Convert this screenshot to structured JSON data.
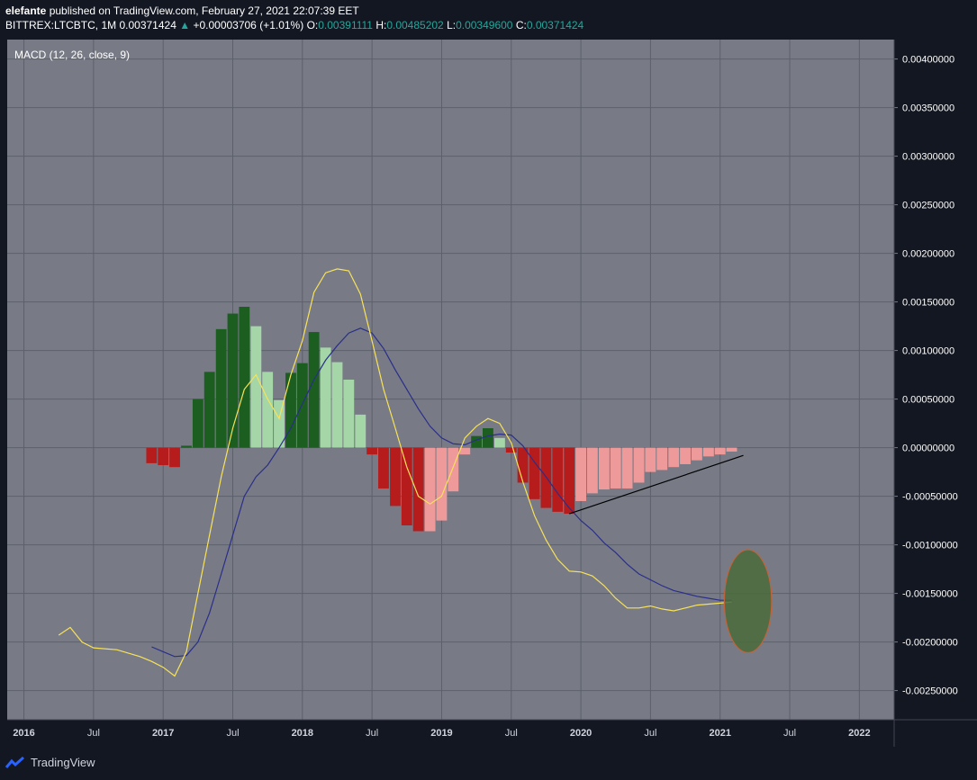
{
  "header": {
    "publisher": "elefante",
    "published_text": "published on TradingView.com, February 27, 2021 22:07:39 EET",
    "symbol": "BITTREX:LTCBTC, 1M",
    "last": "0.00371424",
    "change_arrow": "▲",
    "change": "+0.00003706 (+1.01%)",
    "o_label": "O:",
    "o_value": "0.00391111",
    "h_label": "H:",
    "h_value": "0.00485202",
    "l_label": "L:",
    "l_value": "0.00349600",
    "c_label": "C:",
    "c_value": "0.00371424"
  },
  "footer": {
    "brand": "TradingView"
  },
  "colors": {
    "panel_bg": "#787b86",
    "grid": "#5d606b",
    "macd_line": "#f7e259",
    "signal_line": "#2a2e8a",
    "hist_pos_strong": "#1b5e20",
    "hist_pos_weak": "#a5d6a7",
    "hist_neg_strong": "#b71c1c",
    "hist_neg_weak": "#ef9a9a",
    "trendline": "#000000",
    "ellipse_fill": "#4a6b3a",
    "ellipse_stroke": "#c0633a"
  },
  "chart_data": {
    "type": "bar",
    "title": "MACD (12, 26, close, 9)",
    "yaxis_ticks": [
      "0.00400000",
      "0.00350000",
      "0.00300000",
      "0.00250000",
      "0.00200000",
      "0.00150000",
      "0.00100000",
      "0.00050000",
      "0.00000000",
      "-0.00050000",
      "-0.00100000",
      "-0.00150000",
      "-0.00200000",
      "-0.00250000"
    ],
    "ylim": [
      -0.0028,
      0.0042
    ],
    "xaxis_ticks": [
      {
        "label": "2016",
        "t": 2016.0
      },
      {
        "label": "Jul",
        "t": 2016.5
      },
      {
        "label": "2017",
        "t": 2017.0
      },
      {
        "label": "Jul",
        "t": 2017.5
      },
      {
        "label": "2018",
        "t": 2018.0
      },
      {
        "label": "Jul",
        "t": 2018.5
      },
      {
        "label": "2019",
        "t": 2019.0
      },
      {
        "label": "Jul",
        "t": 2019.5
      },
      {
        "label": "2020",
        "t": 2020.0
      },
      {
        "label": "Jul",
        "t": 2020.5
      },
      {
        "label": "2021",
        "t": 2021.0
      },
      {
        "label": "Jul",
        "t": 2021.5
      },
      {
        "label": "2022",
        "t": 2022.0
      }
    ],
    "xlim": [
      2015.88,
      2022.25
    ],
    "histogram": [
      {
        "t": 2016.917,
        "v": -0.00016,
        "c": "neg_strong"
      },
      {
        "t": 2017.0,
        "v": -0.00018,
        "c": "neg_strong"
      },
      {
        "t": 2017.083,
        "v": -0.0002,
        "c": "neg_strong"
      },
      {
        "t": 2017.167,
        "v": 2e-05,
        "c": "pos_strong"
      },
      {
        "t": 2017.25,
        "v": 0.0005,
        "c": "pos_strong"
      },
      {
        "t": 2017.333,
        "v": 0.00078,
        "c": "pos_strong"
      },
      {
        "t": 2017.417,
        "v": 0.00122,
        "c": "pos_strong"
      },
      {
        "t": 2017.5,
        "v": 0.00138,
        "c": "pos_strong"
      },
      {
        "t": 2017.583,
        "v": 0.00145,
        "c": "pos_strong"
      },
      {
        "t": 2017.667,
        "v": 0.00125,
        "c": "pos_weak"
      },
      {
        "t": 2017.75,
        "v": 0.00078,
        "c": "pos_weak"
      },
      {
        "t": 2017.833,
        "v": 0.00049,
        "c": "pos_weak"
      },
      {
        "t": 2017.917,
        "v": 0.00077,
        "c": "pos_strong"
      },
      {
        "t": 2018.0,
        "v": 0.00087,
        "c": "pos_strong"
      },
      {
        "t": 2018.083,
        "v": 0.00119,
        "c": "pos_strong"
      },
      {
        "t": 2018.167,
        "v": 0.00103,
        "c": "pos_weak"
      },
      {
        "t": 2018.25,
        "v": 0.00088,
        "c": "pos_weak"
      },
      {
        "t": 2018.333,
        "v": 0.0007,
        "c": "pos_weak"
      },
      {
        "t": 2018.417,
        "v": 0.00034,
        "c": "pos_weak"
      },
      {
        "t": 2018.5,
        "v": -7e-05,
        "c": "neg_strong"
      },
      {
        "t": 2018.583,
        "v": -0.00042,
        "c": "neg_strong"
      },
      {
        "t": 2018.667,
        "v": -0.0006,
        "c": "neg_strong"
      },
      {
        "t": 2018.75,
        "v": -0.0008,
        "c": "neg_strong"
      },
      {
        "t": 2018.833,
        "v": -0.00086,
        "c": "neg_strong"
      },
      {
        "t": 2018.917,
        "v": -0.00086,
        "c": "neg_weak"
      },
      {
        "t": 2019.0,
        "v": -0.00075,
        "c": "neg_weak"
      },
      {
        "t": 2019.083,
        "v": -0.00045,
        "c": "neg_weak"
      },
      {
        "t": 2019.167,
        "v": -7e-05,
        "c": "neg_weak"
      },
      {
        "t": 2019.25,
        "v": 0.00012,
        "c": "pos_strong"
      },
      {
        "t": 2019.333,
        "v": 0.0002,
        "c": "pos_strong"
      },
      {
        "t": 2019.417,
        "v": 0.0001,
        "c": "pos_weak"
      },
      {
        "t": 2019.5,
        "v": -5e-05,
        "c": "neg_strong"
      },
      {
        "t": 2019.583,
        "v": -0.00036,
        "c": "neg_strong"
      },
      {
        "t": 2019.667,
        "v": -0.00053,
        "c": "neg_strong"
      },
      {
        "t": 2019.75,
        "v": -0.00062,
        "c": "neg_strong"
      },
      {
        "t": 2019.833,
        "v": -0.00066,
        "c": "neg_strong"
      },
      {
        "t": 2019.917,
        "v": -0.00068,
        "c": "neg_strong"
      },
      {
        "t": 2020.0,
        "v": -0.00055,
        "c": "neg_weak"
      },
      {
        "t": 2020.083,
        "v": -0.00047,
        "c": "neg_weak"
      },
      {
        "t": 2020.167,
        "v": -0.00043,
        "c": "neg_weak"
      },
      {
        "t": 2020.25,
        "v": -0.00042,
        "c": "neg_weak"
      },
      {
        "t": 2020.333,
        "v": -0.00042,
        "c": "neg_weak"
      },
      {
        "t": 2020.417,
        "v": -0.00036,
        "c": "neg_weak"
      },
      {
        "t": 2020.5,
        "v": -0.00025,
        "c": "neg_weak"
      },
      {
        "t": 2020.583,
        "v": -0.00023,
        "c": "neg_weak"
      },
      {
        "t": 2020.667,
        "v": -0.0002,
        "c": "neg_weak"
      },
      {
        "t": 2020.75,
        "v": -0.00017,
        "c": "neg_weak"
      },
      {
        "t": 2020.833,
        "v": -0.00013,
        "c": "neg_weak"
      },
      {
        "t": 2020.917,
        "v": -9e-05,
        "c": "neg_weak"
      },
      {
        "t": 2021.0,
        "v": -7e-05,
        "c": "neg_weak"
      },
      {
        "t": 2021.083,
        "v": -4e-05,
        "c": "neg_weak"
      }
    ],
    "macd_line": [
      [
        2016.25,
        -0.00193
      ],
      [
        2016.333,
        -0.00185
      ],
      [
        2016.417,
        -0.002
      ],
      [
        2016.5,
        -0.00206
      ],
      [
        2016.667,
        -0.00208
      ],
      [
        2016.833,
        -0.00215
      ],
      [
        2016.917,
        -0.0022
      ],
      [
        2017.0,
        -0.00226
      ],
      [
        2017.083,
        -0.00235
      ],
      [
        2017.167,
        -0.0021
      ],
      [
        2017.25,
        -0.0015
      ],
      [
        2017.333,
        -0.0009
      ],
      [
        2017.417,
        -0.0003
      ],
      [
        2017.5,
        0.0002
      ],
      [
        2017.583,
        0.0006
      ],
      [
        2017.667,
        0.00075
      ],
      [
        2017.75,
        0.0005
      ],
      [
        2017.833,
        0.0003
      ],
      [
        2017.917,
        0.00075
      ],
      [
        2018.0,
        0.0011
      ],
      [
        2018.083,
        0.0016
      ],
      [
        2018.167,
        0.0018
      ],
      [
        2018.25,
        0.00184
      ],
      [
        2018.333,
        0.00182
      ],
      [
        2018.417,
        0.00158
      ],
      [
        2018.5,
        0.0011
      ],
      [
        2018.583,
        0.0006
      ],
      [
        2018.667,
        0.0002
      ],
      [
        2018.75,
        -0.0002
      ],
      [
        2018.833,
        -0.0005
      ],
      [
        2018.917,
        -0.00058
      ],
      [
        2019.0,
        -0.0005
      ],
      [
        2019.083,
        -0.0002
      ],
      [
        2019.167,
        0.0001
      ],
      [
        2019.25,
        0.00022
      ],
      [
        2019.333,
        0.0003
      ],
      [
        2019.417,
        0.00025
      ],
      [
        2019.5,
        5e-05
      ],
      [
        2019.583,
        -0.00035
      ],
      [
        2019.667,
        -0.0007
      ],
      [
        2019.75,
        -0.00095
      ],
      [
        2019.833,
        -0.00115
      ],
      [
        2019.917,
        -0.00127
      ],
      [
        2020.0,
        -0.00128
      ],
      [
        2020.083,
        -0.00132
      ],
      [
        2020.167,
        -0.00142
      ],
      [
        2020.25,
        -0.00155
      ],
      [
        2020.333,
        -0.00165
      ],
      [
        2020.417,
        -0.00165
      ],
      [
        2020.5,
        -0.00163
      ],
      [
        2020.583,
        -0.00166
      ],
      [
        2020.667,
        -0.00168
      ],
      [
        2020.75,
        -0.00165
      ],
      [
        2020.833,
        -0.00162
      ],
      [
        2020.917,
        -0.00161
      ],
      [
        2021.0,
        -0.0016
      ],
      [
        2021.083,
        -0.00159
      ]
    ],
    "signal_line": [
      [
        2016.917,
        -0.00205
      ],
      [
        2017.0,
        -0.0021
      ],
      [
        2017.083,
        -0.00215
      ],
      [
        2017.167,
        -0.00214
      ],
      [
        2017.25,
        -0.002
      ],
      [
        2017.333,
        -0.0017
      ],
      [
        2017.417,
        -0.0013
      ],
      [
        2017.5,
        -0.0009
      ],
      [
        2017.583,
        -0.0005
      ],
      [
        2017.667,
        -0.0003
      ],
      [
        2017.75,
        -0.00018
      ],
      [
        2017.833,
        0.0
      ],
      [
        2017.917,
        0.0002
      ],
      [
        2018.0,
        0.00045
      ],
      [
        2018.083,
        0.0007
      ],
      [
        2018.167,
        0.0009
      ],
      [
        2018.25,
        0.00105
      ],
      [
        2018.333,
        0.00118
      ],
      [
        2018.417,
        0.00123
      ],
      [
        2018.5,
        0.00118
      ],
      [
        2018.583,
        0.00102
      ],
      [
        2018.667,
        0.0008
      ],
      [
        2018.75,
        0.0006
      ],
      [
        2018.833,
        0.0004
      ],
      [
        2018.917,
        0.00022
      ],
      [
        2019.0,
        0.0001
      ],
      [
        2019.083,
        4e-05
      ],
      [
        2019.167,
        3e-05
      ],
      [
        2019.25,
        8e-05
      ],
      [
        2019.333,
        0.00012
      ],
      [
        2019.417,
        0.00014
      ],
      [
        2019.5,
        0.00013
      ],
      [
        2019.583,
        2e-05
      ],
      [
        2019.667,
        -0.00015
      ],
      [
        2019.75,
        -0.0003
      ],
      [
        2019.833,
        -0.00047
      ],
      [
        2019.917,
        -0.00062
      ],
      [
        2020.0,
        -0.00075
      ],
      [
        2020.083,
        -0.00085
      ],
      [
        2020.167,
        -0.00098
      ],
      [
        2020.25,
        -0.00108
      ],
      [
        2020.333,
        -0.0012
      ],
      [
        2020.417,
        -0.0013
      ],
      [
        2020.5,
        -0.00136
      ],
      [
        2020.583,
        -0.00142
      ],
      [
        2020.667,
        -0.00147
      ],
      [
        2020.75,
        -0.0015
      ],
      [
        2020.833,
        -0.00153
      ],
      [
        2020.917,
        -0.00155
      ],
      [
        2021.0,
        -0.00157
      ],
      [
        2021.083,
        -0.00157
      ]
    ],
    "trendline": [
      [
        2019.917,
        -0.00068
      ],
      [
        2021.167,
        -8e-05
      ]
    ],
    "ellipse": {
      "t": 2021.2,
      "v": -0.00158,
      "rt": 0.17,
      "rv": 0.00053
    }
  }
}
